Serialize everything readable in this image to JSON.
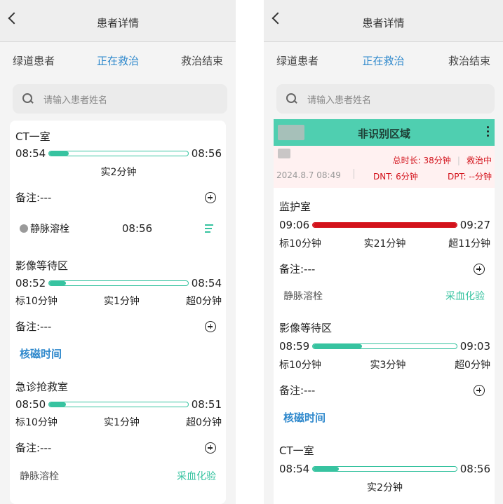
{
  "header": {
    "title": "患者详情"
  },
  "tabs": [
    "绿道患者",
    "正在救治",
    "救治结束"
  ],
  "search": {
    "placeholder": "请输入患者姓名"
  },
  "left": {
    "sec1": {
      "room": "CT一室",
      "start": "08:54",
      "end": "08:56",
      "progress": 0.14,
      "actual": "实2分钟",
      "note": "备注:---",
      "person": "静脉溶栓",
      "time": "08:56"
    },
    "sec2": {
      "room": "影像等待区",
      "start": "08:52",
      "end": "08:54",
      "progress": 0.12,
      "std": "标10分钟",
      "actual": "实1分钟",
      "over": "超0分钟",
      "note": "备注:---",
      "link": "核磁时间"
    },
    "sec3": {
      "room": "急诊抢救室",
      "start": "08:50",
      "end": "08:51",
      "progress": 0.12,
      "std": "标10分钟",
      "actual": "实1分钟",
      "over": "超0分钟",
      "note": "备注:---",
      "left_label": "静脉溶栓",
      "right_label": "采血化验"
    }
  },
  "right": {
    "card": {
      "zone": "非识别区域",
      "total": "总时长: 38分钟",
      "status": "救治中",
      "date": "2024.8.7 08:49",
      "dnt": "DNT: 6分钟",
      "dpt": "DPT: --分钟"
    },
    "sec1": {
      "room": "监护室",
      "start": "09:06",
      "end": "09:27",
      "progress": 1.0,
      "std": "标10分钟",
      "actual": "实21分钟",
      "over": "超11分钟",
      "note": "备注:---",
      "left_label": "静脉溶栓",
      "right_label": "采血化验"
    },
    "sec2": {
      "room": "影像等待区",
      "start": "08:59",
      "end": "09:03",
      "progress": 0.34,
      "std": "标10分钟",
      "actual": "实3分钟",
      "over": "超0分钟",
      "note": "备注:---",
      "link": "核磁时间"
    },
    "sec3": {
      "room": "CT一室",
      "start": "08:54",
      "end": "08:56",
      "progress": 0.18,
      "actual": "实2分钟"
    }
  },
  "colors": {
    "accent": "#2e88cc",
    "teal": "#37c3a0",
    "red": "#d3121b"
  }
}
